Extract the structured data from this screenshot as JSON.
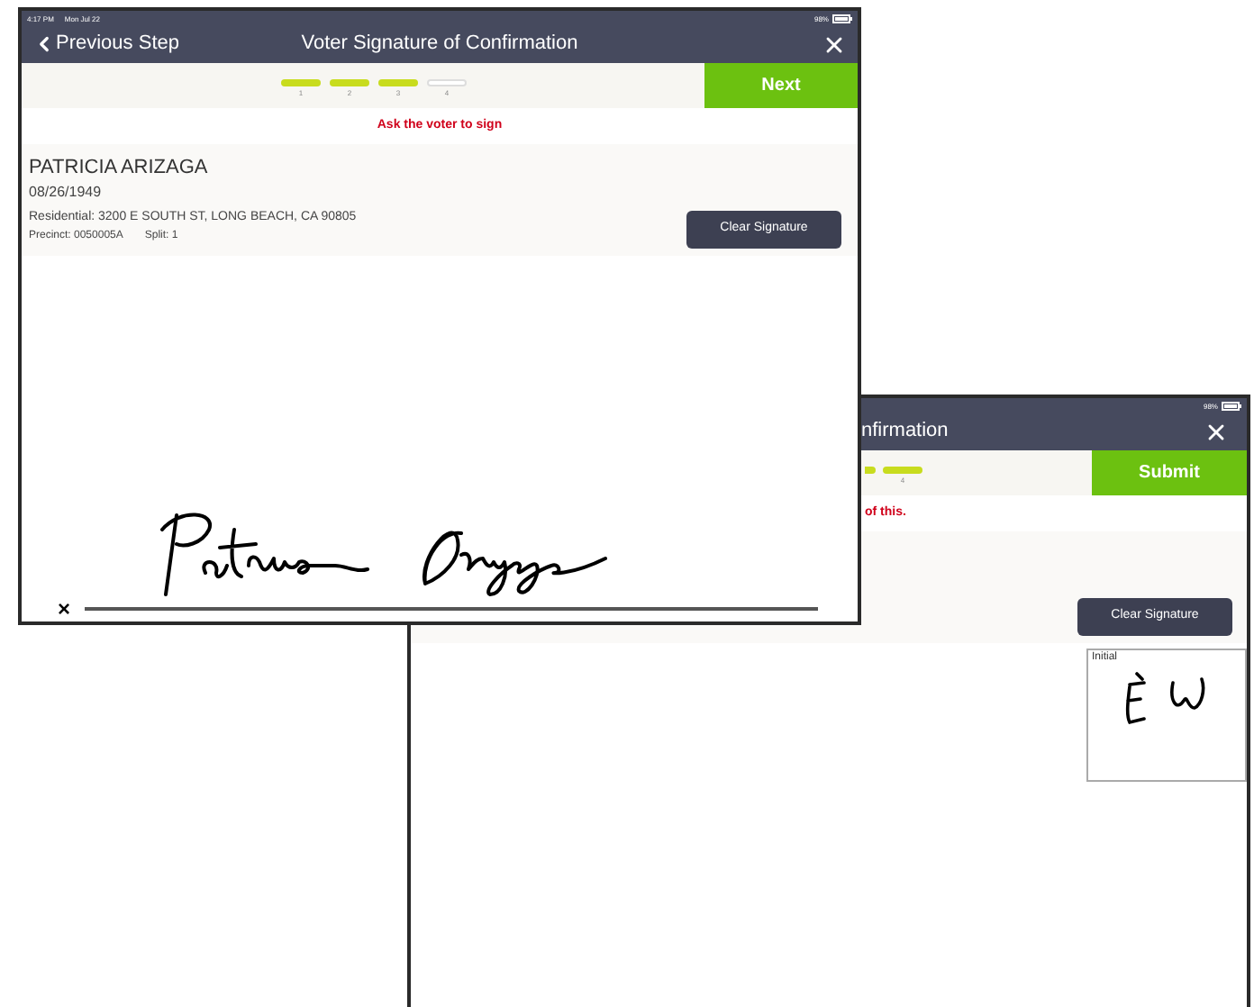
{
  "front_window": {
    "status": {
      "time": "4:17 PM",
      "date": "Mon Jul 22",
      "battery": "98%"
    },
    "back": "Previous Step",
    "title": "Voter Signature of Confirmation",
    "steps": [
      {
        "label": "1",
        "done": true
      },
      {
        "label": "2",
        "done": true
      },
      {
        "label": "3",
        "done": true
      },
      {
        "label": "4",
        "done": false
      }
    ],
    "next": "Next",
    "instruction": "Ask the voter to sign",
    "voter": {
      "name": "PATRICIA ARIZAGA",
      "dob": "08/26/1949",
      "residential": "Residential: 3200 E SOUTH ST, LONG BEACH, CA 90805",
      "precinct": "Precinct: 0050005A",
      "split": "Split: 1"
    },
    "clear": "Clear Signature",
    "sign_mark": "×"
  },
  "back_window": {
    "status": {
      "battery": "98%"
    },
    "title": "nfirmation",
    "steps": [
      {
        "label": "4",
        "done": true
      }
    ],
    "submit": "Submit",
    "instruction": "of this.",
    "clear": "Clear Signature",
    "initial_label": "Initial"
  }
}
